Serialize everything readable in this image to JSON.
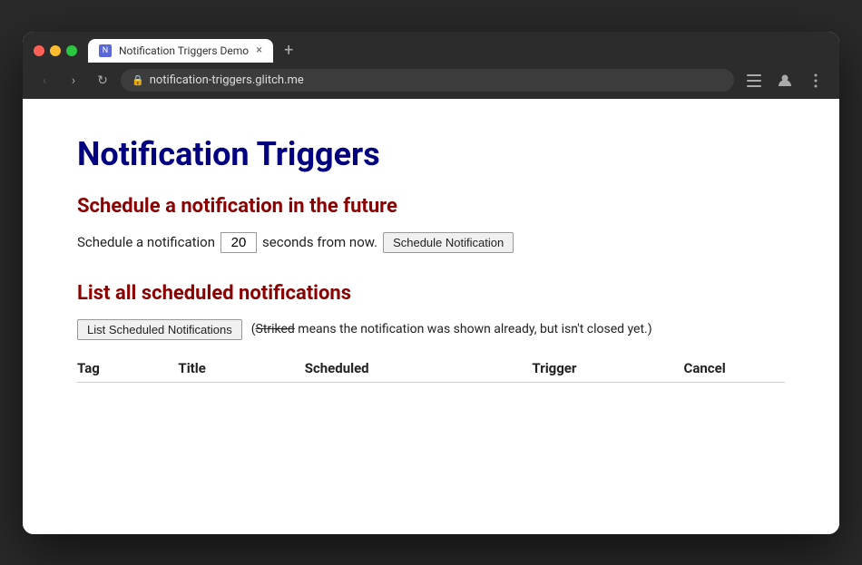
{
  "browser": {
    "tab": {
      "favicon_label": "N",
      "title": "Notification Triggers Demo",
      "close_icon": "×"
    },
    "new_tab_icon": "+",
    "nav": {
      "back_icon": "‹",
      "forward_icon": "›",
      "reload_icon": "↻"
    },
    "url": {
      "lock_icon": "🔒",
      "address": "notification-triggers.glitch.me"
    },
    "toolbar": {
      "menu_icon": "≡",
      "profile_icon": "👤",
      "more_icon": "⋮"
    }
  },
  "page": {
    "title": "Notification Triggers",
    "sections": {
      "schedule": {
        "heading": "Schedule a notification in the future",
        "label_before": "Schedule a notification",
        "input_value": "20",
        "label_after": "seconds from now.",
        "button_label": "Schedule Notification"
      },
      "list": {
        "heading": "List all scheduled notifications",
        "button_label": "List Scheduled Notifications",
        "note_prefix": "(",
        "note_strikethrough": "Striked",
        "note_suffix": " means the notification was shown already, but isn't closed yet.)",
        "table": {
          "columns": [
            "Tag",
            "Title",
            "Scheduled",
            "Trigger",
            "Cancel"
          ],
          "rows": []
        }
      }
    }
  }
}
